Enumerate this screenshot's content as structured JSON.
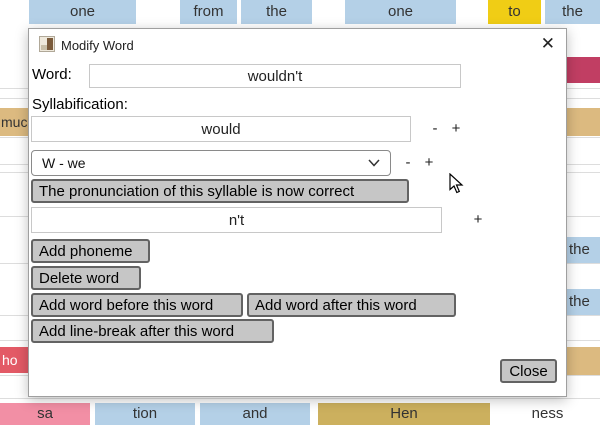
{
  "colors": {
    "word_blue": "#b4d0e7",
    "word_yellow": "#f0cd15",
    "word_pink": "#f28fa5",
    "word_magenta": "#c13e63",
    "word_tan": "#dcba80",
    "word_khaki": "#ccb05e",
    "word_red": "#e35a66",
    "word_white": "#ffffff",
    "button_fill": "#c6c6c6",
    "button_border": "#636363"
  },
  "background": {
    "top_row": [
      {
        "label": "one"
      },
      {
        "label": "from"
      },
      {
        "label": "the"
      },
      {
        "label": "one"
      },
      {
        "label": "to"
      },
      {
        "label": "the"
      }
    ],
    "left_column": [
      {
        "label": "muc"
      },
      {
        "label": "ho"
      }
    ],
    "right_column": [
      {
        "label": "the"
      },
      {
        "label": "the"
      }
    ],
    "bottom_row": [
      {
        "label": "sa"
      },
      {
        "label": "tion"
      },
      {
        "label": "and"
      },
      {
        "label": "Hen"
      },
      {
        "label": "ness"
      }
    ]
  },
  "dialog": {
    "title": "Modify Word",
    "close_icon": "✕",
    "word_label": "Word:",
    "word_value": "wouldn't",
    "syllabification_label": "Syllabification:",
    "syllable1_value": "would",
    "phoneme_selected": "W - we",
    "pronunciation_correct_label": "The pronunciation of this syllable is now correct",
    "syllable2_value": "n't",
    "minus_label": "-",
    "plus_label": "+",
    "add_phoneme_label": "Add phoneme",
    "delete_word_label": "Delete word",
    "add_word_before_label": "Add word before this word",
    "add_word_after_label": "Add word after this word",
    "add_line_break_label": "Add line-break after this word",
    "close_label": "Close"
  }
}
